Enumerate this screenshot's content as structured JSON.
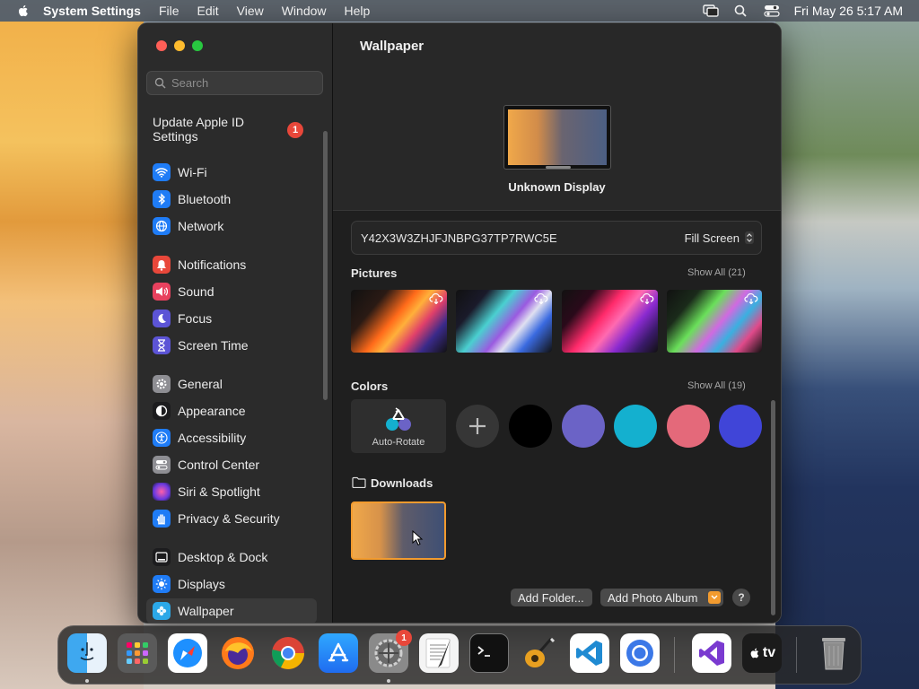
{
  "menubar": {
    "app_name": "System Settings",
    "menus": [
      "File",
      "Edit",
      "View",
      "Window",
      "Help"
    ],
    "clock": "Fri May 26  5:17 AM"
  },
  "sidebar": {
    "search_placeholder": "Search",
    "apple_id_label": "Update Apple ID Settings",
    "apple_id_badge": "1",
    "items": [
      {
        "label": "Wi-Fi",
        "icon": "wifi-icon",
        "color": "#1f7cf6"
      },
      {
        "label": "Bluetooth",
        "icon": "bluetooth-icon",
        "color": "#1f7cf6"
      },
      {
        "label": "Network",
        "icon": "globe-icon",
        "color": "#1f7cf6"
      },
      {
        "label": "Notifications",
        "icon": "bell-icon",
        "color": "#e8473a"
      },
      {
        "label": "Sound",
        "icon": "speaker-icon",
        "color": "#e8415e"
      },
      {
        "label": "Focus",
        "icon": "moon-icon",
        "color": "#5c54d6"
      },
      {
        "label": "Screen Time",
        "icon": "hourglass-icon",
        "color": "#5c54d6"
      },
      {
        "label": "General",
        "icon": "gear-icon",
        "color": "#8e8e93"
      },
      {
        "label": "Appearance",
        "icon": "appearance-icon",
        "color": "#1c1c1e"
      },
      {
        "label": "Accessibility",
        "icon": "accessibility-icon",
        "color": "#1f7cf6"
      },
      {
        "label": "Control Center",
        "icon": "toggles-icon",
        "color": "#8e8e93"
      },
      {
        "label": "Siri & Spotlight",
        "icon": "siri-icon",
        "color": "#8a3ad6"
      },
      {
        "label": "Privacy & Security",
        "icon": "hand-icon",
        "color": "#1f7cf6"
      },
      {
        "label": "Desktop & Dock",
        "icon": "dock-icon",
        "color": "#1c1c1e"
      },
      {
        "label": "Displays",
        "icon": "sun-icon",
        "color": "#1f7cf6"
      },
      {
        "label": "Wallpaper",
        "icon": "flower-icon",
        "color": "#2ba8e8"
      }
    ]
  },
  "main": {
    "title": "Wallpaper",
    "display_name": "Unknown Display",
    "current_wallpaper": "Y42X3W3ZHJFJNBPG37TP7RWC5E",
    "fit_mode": "Fill Screen",
    "pictures": {
      "label": "Pictures",
      "show_all": "Show All (21)"
    },
    "colors": {
      "label": "Colors",
      "show_all": "Show All (19)",
      "auto_rotate_label": "Auto-Rotate",
      "swatches": [
        "#000000",
        "#6b63c6",
        "#14b0cf",
        "#e4697a",
        "#4045d8"
      ]
    },
    "downloads_label": "Downloads",
    "add_folder_label": "Add Folder...",
    "add_photo_album_label": "Add Photo Album",
    "help_label": "?"
  },
  "dock": {
    "settings_badge": "1",
    "tv_label": "tv"
  }
}
